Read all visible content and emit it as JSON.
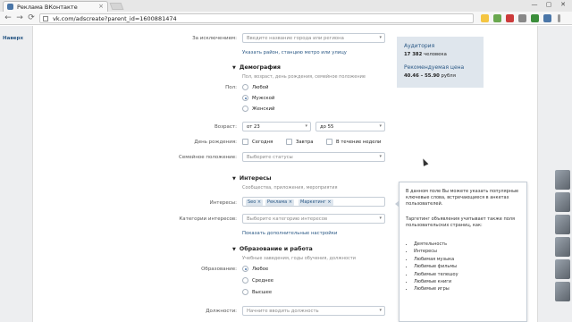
{
  "browser": {
    "tab_title": "Реклама ВКонтакте",
    "tab_close": "×",
    "url": "vk.com/adscreate?parent_id=1600881474",
    "back": "←",
    "forward": "→",
    "reload": "⟳",
    "window_controls": [
      "—",
      "▢",
      "✕"
    ]
  },
  "nav": {
    "back_link": "Наверх"
  },
  "exclusions": {
    "label": "За исключением:",
    "placeholder": "Введите название города или региона",
    "link": "Указать район, станцию метро или улицу"
  },
  "demography": {
    "title": "Демография",
    "subtitle": "Пол, возраст, день рождения, семейное положение",
    "gender_label": "Пол:",
    "gender_options": [
      "Любой",
      "Мужской",
      "Женский"
    ],
    "gender_selected": "Мужской",
    "age_label": "Возраст:",
    "age_from": "от 23",
    "age_to": "до 55",
    "birthday_label": "День рождения:",
    "birthday_options": [
      "Сегодня",
      "Завтра",
      "В течение недели"
    ],
    "marital_label": "Семейное положение:",
    "marital_placeholder": "Выберите статусы"
  },
  "interests": {
    "title": "Интересы",
    "subtitle": "Сообщества, приложения, мероприятия",
    "label": "Интересы:",
    "tags": [
      "Seo",
      "Реклама",
      "Маркетинг"
    ],
    "category_label": "Категории интересов:",
    "category_placeholder": "Выберите категорию интересов",
    "more_link": "Показать дополнительные настройки"
  },
  "education": {
    "title": "Образование и работа",
    "subtitle": "Учебные заведения, годы обучения, должности",
    "label": "Образование:",
    "options": [
      "Любое",
      "Среднее",
      "Высшее"
    ],
    "selected": "Любое",
    "position_label": "Должности:",
    "position_placeholder": "Начните вводить должность"
  },
  "stats": {
    "audience_title": "Аудитория",
    "audience_value": "17 382",
    "audience_unit": "человека",
    "price_title": "Рекомендуемая цена",
    "price_value": "40.46 – 55.90",
    "price_unit": "рубля"
  },
  "tooltip": {
    "para1": "В данном поле Вы можете указать популярные ключевые слова, встречающиеся в анкетах пользователей.",
    "para2": "Таргетинг объявления учитывает также поля пользовательских страниц, как:",
    "items": [
      "Деятельность",
      "Интересы",
      "Любимая музыка",
      "Любимые фильмы",
      "Любимые телешоу",
      "Любимые книги",
      "Любимые игры"
    ]
  },
  "colors": {
    "accent": "#4a76a8",
    "link": "#2a5885",
    "panel": "#dfe6ed"
  }
}
